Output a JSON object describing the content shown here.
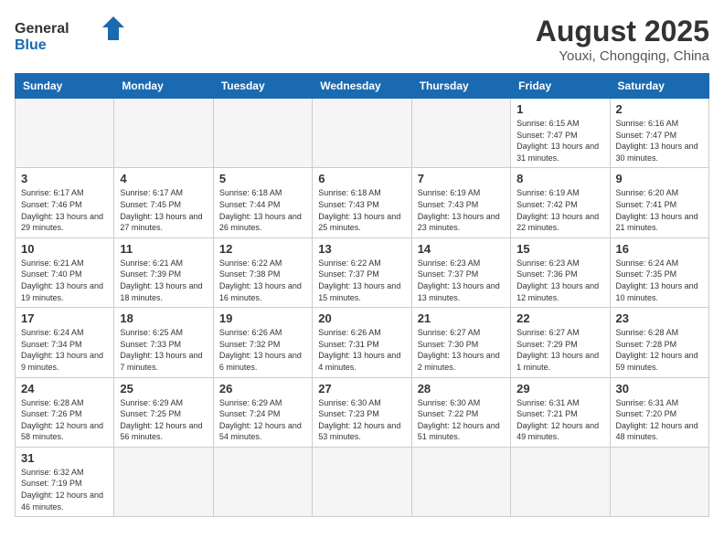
{
  "header": {
    "logo_general": "General",
    "logo_blue": "Blue",
    "month_year": "August 2025",
    "location": "Youxi, Chongqing, China"
  },
  "weekdays": [
    "Sunday",
    "Monday",
    "Tuesday",
    "Wednesday",
    "Thursday",
    "Friday",
    "Saturday"
  ],
  "days": [
    {
      "num": "",
      "info": "",
      "empty": true
    },
    {
      "num": "",
      "info": "",
      "empty": true
    },
    {
      "num": "",
      "info": "",
      "empty": true
    },
    {
      "num": "",
      "info": "",
      "empty": true
    },
    {
      "num": "",
      "info": "",
      "empty": true
    },
    {
      "num": "1",
      "info": "Sunrise: 6:15 AM\nSunset: 7:47 PM\nDaylight: 13 hours and 31 minutes."
    },
    {
      "num": "2",
      "info": "Sunrise: 6:16 AM\nSunset: 7:47 PM\nDaylight: 13 hours and 30 minutes."
    },
    {
      "num": "3",
      "info": "Sunrise: 6:17 AM\nSunset: 7:46 PM\nDaylight: 13 hours and 29 minutes."
    },
    {
      "num": "4",
      "info": "Sunrise: 6:17 AM\nSunset: 7:45 PM\nDaylight: 13 hours and 27 minutes."
    },
    {
      "num": "5",
      "info": "Sunrise: 6:18 AM\nSunset: 7:44 PM\nDaylight: 13 hours and 26 minutes."
    },
    {
      "num": "6",
      "info": "Sunrise: 6:18 AM\nSunset: 7:43 PM\nDaylight: 13 hours and 25 minutes."
    },
    {
      "num": "7",
      "info": "Sunrise: 6:19 AM\nSunset: 7:43 PM\nDaylight: 13 hours and 23 minutes."
    },
    {
      "num": "8",
      "info": "Sunrise: 6:19 AM\nSunset: 7:42 PM\nDaylight: 13 hours and 22 minutes."
    },
    {
      "num": "9",
      "info": "Sunrise: 6:20 AM\nSunset: 7:41 PM\nDaylight: 13 hours and 21 minutes."
    },
    {
      "num": "10",
      "info": "Sunrise: 6:21 AM\nSunset: 7:40 PM\nDaylight: 13 hours and 19 minutes."
    },
    {
      "num": "11",
      "info": "Sunrise: 6:21 AM\nSunset: 7:39 PM\nDaylight: 13 hours and 18 minutes."
    },
    {
      "num": "12",
      "info": "Sunrise: 6:22 AM\nSunset: 7:38 PM\nDaylight: 13 hours and 16 minutes."
    },
    {
      "num": "13",
      "info": "Sunrise: 6:22 AM\nSunset: 7:37 PM\nDaylight: 13 hours and 15 minutes."
    },
    {
      "num": "14",
      "info": "Sunrise: 6:23 AM\nSunset: 7:37 PM\nDaylight: 13 hours and 13 minutes."
    },
    {
      "num": "15",
      "info": "Sunrise: 6:23 AM\nSunset: 7:36 PM\nDaylight: 13 hours and 12 minutes."
    },
    {
      "num": "16",
      "info": "Sunrise: 6:24 AM\nSunset: 7:35 PM\nDaylight: 13 hours and 10 minutes."
    },
    {
      "num": "17",
      "info": "Sunrise: 6:24 AM\nSunset: 7:34 PM\nDaylight: 13 hours and 9 minutes."
    },
    {
      "num": "18",
      "info": "Sunrise: 6:25 AM\nSunset: 7:33 PM\nDaylight: 13 hours and 7 minutes."
    },
    {
      "num": "19",
      "info": "Sunrise: 6:26 AM\nSunset: 7:32 PM\nDaylight: 13 hours and 6 minutes."
    },
    {
      "num": "20",
      "info": "Sunrise: 6:26 AM\nSunset: 7:31 PM\nDaylight: 13 hours and 4 minutes."
    },
    {
      "num": "21",
      "info": "Sunrise: 6:27 AM\nSunset: 7:30 PM\nDaylight: 13 hours and 2 minutes."
    },
    {
      "num": "22",
      "info": "Sunrise: 6:27 AM\nSunset: 7:29 PM\nDaylight: 13 hours and 1 minute."
    },
    {
      "num": "23",
      "info": "Sunrise: 6:28 AM\nSunset: 7:28 PM\nDaylight: 12 hours and 59 minutes."
    },
    {
      "num": "24",
      "info": "Sunrise: 6:28 AM\nSunset: 7:26 PM\nDaylight: 12 hours and 58 minutes."
    },
    {
      "num": "25",
      "info": "Sunrise: 6:29 AM\nSunset: 7:25 PM\nDaylight: 12 hours and 56 minutes."
    },
    {
      "num": "26",
      "info": "Sunrise: 6:29 AM\nSunset: 7:24 PM\nDaylight: 12 hours and 54 minutes."
    },
    {
      "num": "27",
      "info": "Sunrise: 6:30 AM\nSunset: 7:23 PM\nDaylight: 12 hours and 53 minutes."
    },
    {
      "num": "28",
      "info": "Sunrise: 6:30 AM\nSunset: 7:22 PM\nDaylight: 12 hours and 51 minutes."
    },
    {
      "num": "29",
      "info": "Sunrise: 6:31 AM\nSunset: 7:21 PM\nDaylight: 12 hours and 49 minutes."
    },
    {
      "num": "30",
      "info": "Sunrise: 6:31 AM\nSunset: 7:20 PM\nDaylight: 12 hours and 48 minutes."
    },
    {
      "num": "31",
      "info": "Sunrise: 6:32 AM\nSunset: 7:19 PM\nDaylight: 12 hours and 46 minutes."
    },
    {
      "num": "",
      "info": "",
      "empty": true
    },
    {
      "num": "",
      "info": "",
      "empty": true
    },
    {
      "num": "",
      "info": "",
      "empty": true
    },
    {
      "num": "",
      "info": "",
      "empty": true
    },
    {
      "num": "",
      "info": "",
      "empty": true
    },
    {
      "num": "",
      "info": "",
      "empty": true
    }
  ]
}
